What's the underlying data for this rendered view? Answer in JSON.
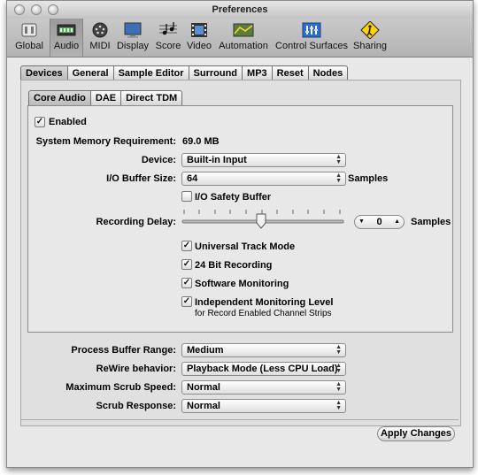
{
  "window": {
    "title": "Preferences"
  },
  "toolbar": {
    "items": [
      {
        "label": "Global",
        "icon": "global-icon"
      },
      {
        "label": "Audio",
        "icon": "audio-icon",
        "selected": true
      },
      {
        "label": "MIDI",
        "icon": "midi-icon"
      },
      {
        "label": "Display",
        "icon": "display-icon"
      },
      {
        "label": "Score",
        "icon": "score-icon"
      },
      {
        "label": "Video",
        "icon": "video-icon"
      },
      {
        "label": "Automation",
        "icon": "automation-icon"
      },
      {
        "label": "Control Surfaces",
        "icon": "control-surfaces-icon"
      },
      {
        "label": "Sharing",
        "icon": "sharing-icon"
      }
    ]
  },
  "main_tabs": [
    "Devices",
    "General",
    "Sample Editor",
    "Surround",
    "MP3",
    "Reset",
    "Nodes"
  ],
  "sub_tabs": [
    "Core Audio",
    "DAE",
    "Direct TDM"
  ],
  "core_audio": {
    "enabled_label": "Enabled",
    "enabled": true,
    "memory_label": "System Memory Requirement:",
    "memory_value": "69.0 MB",
    "device_label": "Device:",
    "device_value": "Built-in Input",
    "buffer_label": "I/O Buffer Size:",
    "buffer_value": "64",
    "buffer_unit": "Samples",
    "safety_label": "I/O Safety Buffer",
    "safety_checked": false,
    "delay_label": "Recording Delay:",
    "delay_slider_fraction": 0.5,
    "delay_value": "0",
    "delay_unit": "Samples",
    "universal_label": "Universal Track Mode",
    "universal_checked": true,
    "bit24_label": "24 Bit Recording",
    "bit24_checked": true,
    "software_label": "Software Monitoring",
    "software_checked": true,
    "independent_label": "Independent Monitoring Level",
    "independent_sub": "for Record Enabled Channel Strips",
    "independent_checked": true
  },
  "general": {
    "process_label": "Process Buffer Range:",
    "process_value": "Medium",
    "rewire_label": "ReWire behavior:",
    "rewire_value": "Playback Mode (Less CPU Load)",
    "scrub_speed_label": "Maximum Scrub Speed:",
    "scrub_speed_value": "Normal",
    "scrub_response_label": "Scrub Response:",
    "scrub_response_value": "Normal"
  },
  "apply_label": "Apply Changes",
  "colors": {
    "window_bg": "#e8e8e8",
    "toolbar_bg": "#bdbdbd",
    "accent": "#2b6ccd"
  }
}
